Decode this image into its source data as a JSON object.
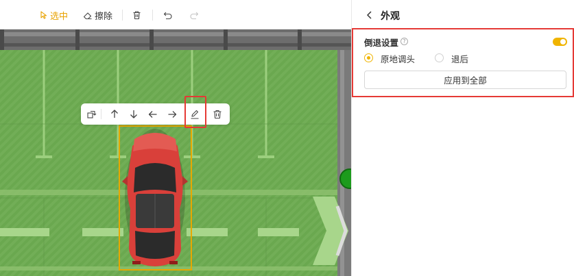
{
  "toolbar": {
    "select_label": "选中",
    "erase_label": "擦除",
    "icons": [
      "cursor-icon",
      "eraser-icon",
      "trash-icon",
      "undo-icon",
      "redo-icon"
    ]
  },
  "float_toolbar": {
    "icons": [
      "rotate-icon",
      "arrow-up-icon",
      "arrow-down-icon",
      "arrow-left-icon",
      "arrow-right-icon",
      "edit-icon",
      "trash-icon"
    ]
  },
  "panel": {
    "title": "外观",
    "section_title": "倒退设置",
    "toggle_on": true,
    "radio_options": [
      {
        "label": "原地调头",
        "checked": true
      },
      {
        "label": "退后",
        "checked": false
      }
    ],
    "apply_label": "应用到全部"
  },
  "colors": {
    "accent": "#f0b400",
    "highlight": "#e53935",
    "field_green": "#6aa84f",
    "car_red": "#d9403a"
  }
}
